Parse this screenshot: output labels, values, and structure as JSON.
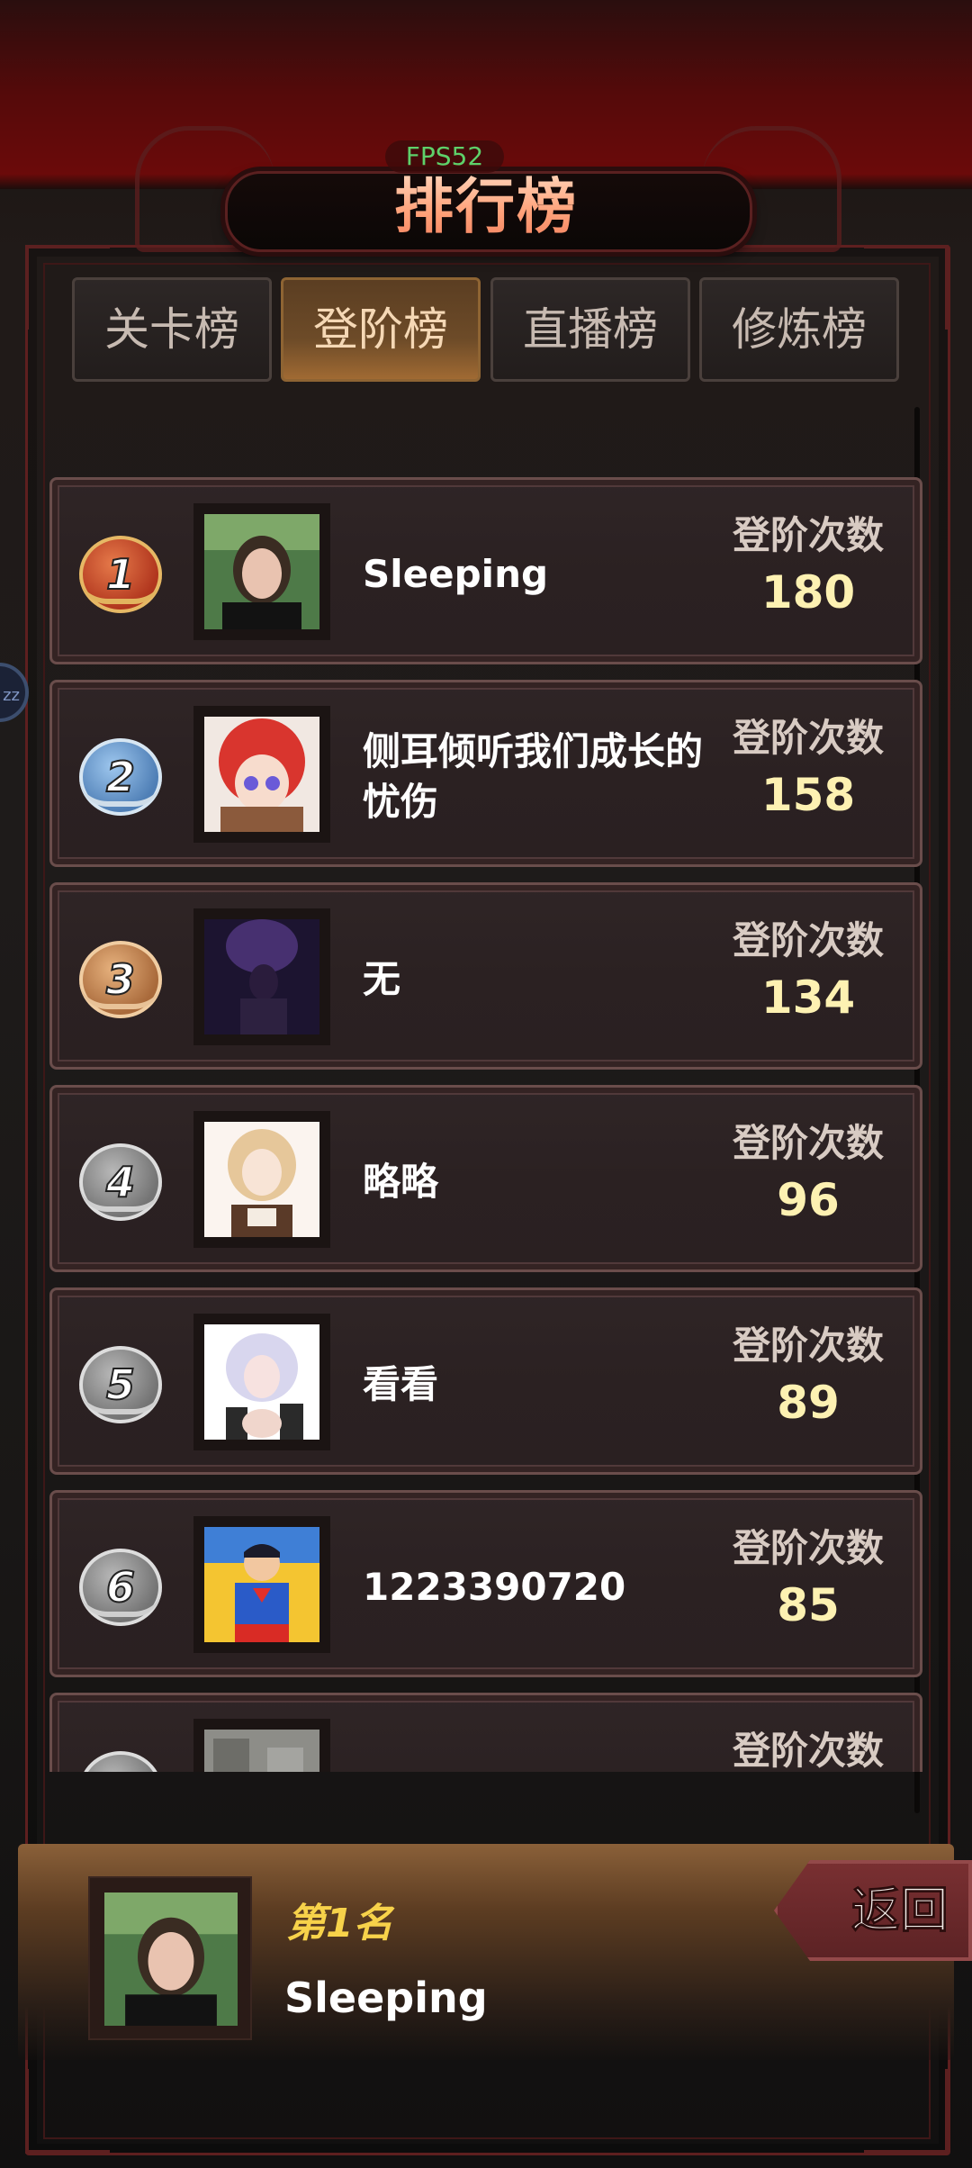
{
  "fps": "FPS52",
  "title": "排行榜",
  "tabs": [
    {
      "label": "关卡榜",
      "active": false
    },
    {
      "label": "登阶榜",
      "active": true
    },
    {
      "label": "直播榜",
      "active": false
    },
    {
      "label": "修炼榜",
      "active": false
    }
  ],
  "stat_label": "登阶次数",
  "rows": [
    {
      "rank": "1",
      "name": "Sleeping",
      "value": "180"
    },
    {
      "rank": "2",
      "name": "侧耳倾听我们成长的忧伤",
      "value": "158"
    },
    {
      "rank": "3",
      "name": "无",
      "value": "134"
    },
    {
      "rank": "4",
      "name": "略略",
      "value": "96"
    },
    {
      "rank": "5",
      "name": "看看",
      "value": "89"
    },
    {
      "rank": "6",
      "name": "1223390720",
      "value": "85"
    },
    {
      "rank": "7",
      "name": "",
      "value": ""
    }
  ],
  "me": {
    "rank_text": "第1名",
    "name": "Sleeping"
  },
  "back_label": "返回",
  "side_bubble": "zz",
  "colors": {
    "accent_gold": "#fdf1b2",
    "title_orange": "#ffa27a",
    "active_tab": "#6d4b28",
    "frame_red": "#5e1f1f"
  }
}
